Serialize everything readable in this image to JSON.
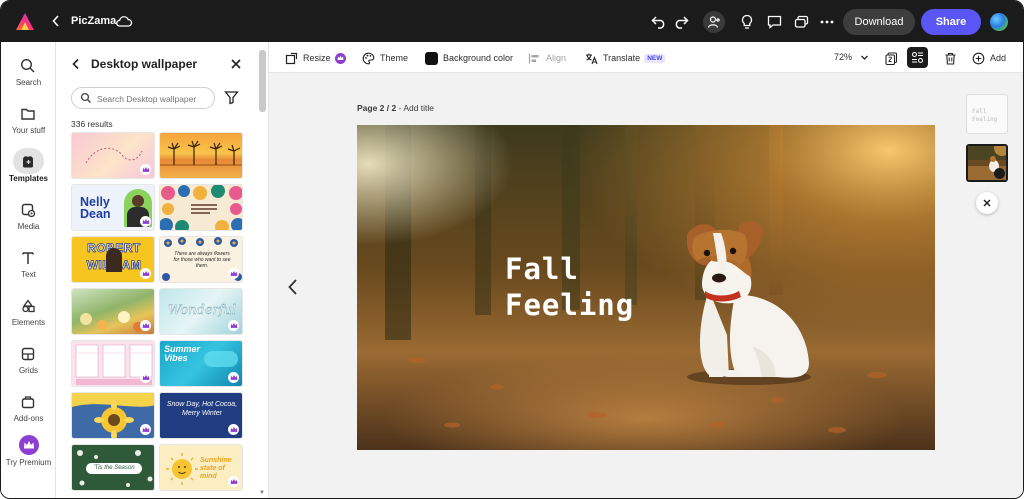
{
  "app": {
    "name": "PicZama"
  },
  "header": {
    "download_label": "Download",
    "share_label": "Share"
  },
  "rail": {
    "items": [
      {
        "label": "Search",
        "icon": "search-icon"
      },
      {
        "label": "Your stuff",
        "icon": "folder-icon"
      },
      {
        "label": "Templates",
        "icon": "templates-icon",
        "active": true
      },
      {
        "label": "Media",
        "icon": "media-icon"
      },
      {
        "label": "Text",
        "icon": "text-icon"
      },
      {
        "label": "Elements",
        "icon": "elements-icon"
      },
      {
        "label": "Grids",
        "icon": "grid-icon"
      },
      {
        "label": "Add-ons",
        "icon": "addons-icon"
      },
      {
        "label": "Try Premium",
        "icon": "crown-icon"
      }
    ]
  },
  "panel": {
    "title": "Desktop wallpaper",
    "search_placeholder": "Search Desktop wallpaper",
    "results": "336 results",
    "thumbs": [
      {
        "text": ""
      },
      {
        "text": ""
      },
      {
        "text": "Nelly Dean"
      },
      {
        "text": ""
      },
      {
        "text": "ROBERT WILLIAM"
      },
      {
        "text": "There are always flowers for those who want to see them."
      },
      {
        "text": ""
      },
      {
        "text": "Wonderful"
      },
      {
        "text": ""
      },
      {
        "text": "Summer Vibes"
      },
      {
        "text": ""
      },
      {
        "text": "Snow Day, Hot Cocoa, Merry Winter"
      },
      {
        "text": "'Tis the Season"
      },
      {
        "text": "Sunshine state of mind"
      }
    ]
  },
  "toolbar": {
    "resize_label": "Resize",
    "theme_label": "Theme",
    "bgcolor_label": "Background color",
    "align_label": "Align",
    "translate_label": "Translate",
    "new_badge": "NEW",
    "zoom": "72%",
    "add_label": "Add"
  },
  "canvas": {
    "page_label": "Page 2 / 2",
    "page_title_placeholder": "Add title",
    "design_line1": "Fall",
    "design_line2": "Feeling"
  },
  "pages": {
    "thumb1_text_line1": "Fall",
    "thumb1_text_line2": "Feeling"
  },
  "colors": {
    "accent": "#5a55f5",
    "topbar": "#1b1b1b",
    "premium": "#8d3fd1"
  }
}
